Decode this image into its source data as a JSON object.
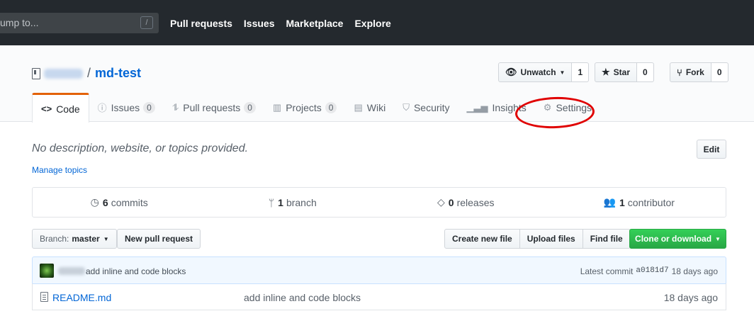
{
  "header": {
    "search_placeholder": "ump to...",
    "search_key": "/",
    "nav": [
      "Pull requests",
      "Issues",
      "Marketplace",
      "Explore"
    ]
  },
  "repo": {
    "owner": "ac2789",
    "separator": "/",
    "name": "md-test",
    "watch": {
      "label": "Unwatch",
      "count": "1"
    },
    "star": {
      "label": "Star",
      "count": "0"
    },
    "fork": {
      "label": "Fork",
      "count": "0"
    }
  },
  "tabs": [
    {
      "label": "Code",
      "icon": "code-icon"
    },
    {
      "label": "Issues",
      "count": "0",
      "icon": "issue-icon"
    },
    {
      "label": "Pull requests",
      "count": "0",
      "icon": "pull-request-icon"
    },
    {
      "label": "Projects",
      "count": "0",
      "icon": "project-icon"
    },
    {
      "label": "Wiki",
      "icon": "book-icon"
    },
    {
      "label": "Security",
      "icon": "shield-icon"
    },
    {
      "label": "Insights",
      "icon": "graph-icon"
    },
    {
      "label": "Settings",
      "icon": "gear-icon"
    }
  ],
  "about": {
    "description": "No description, website, or topics provided.",
    "manage_topics": "Manage topics",
    "edit": "Edit"
  },
  "summary": {
    "commits": {
      "count": "6",
      "label": "commits"
    },
    "branches": {
      "count": "1",
      "label": "branch"
    },
    "releases": {
      "count": "0",
      "label": "releases"
    },
    "contributors": {
      "count": "1",
      "label": "contributor"
    }
  },
  "toolbar": {
    "branch_label": "Branch:",
    "branch_value": "master",
    "new_pr": "New pull request",
    "create_file": "Create new file",
    "upload_files": "Upload files",
    "find_file": "Find file",
    "clone": "Clone or download"
  },
  "latest_commit": {
    "author": "ac2789",
    "message": "add inline and code blocks",
    "label": "Latest commit",
    "sha": "a0181d7",
    "age": "18 days ago"
  },
  "files": [
    {
      "name": "README.md",
      "message": "add inline and code blocks",
      "age": "18 days ago"
    }
  ],
  "colors": {
    "header_bg": "#24292e",
    "link": "#0366d6",
    "selected_tab_border": "#e36209",
    "clone_green": "#28a745",
    "annotation_red": "#e00000"
  }
}
